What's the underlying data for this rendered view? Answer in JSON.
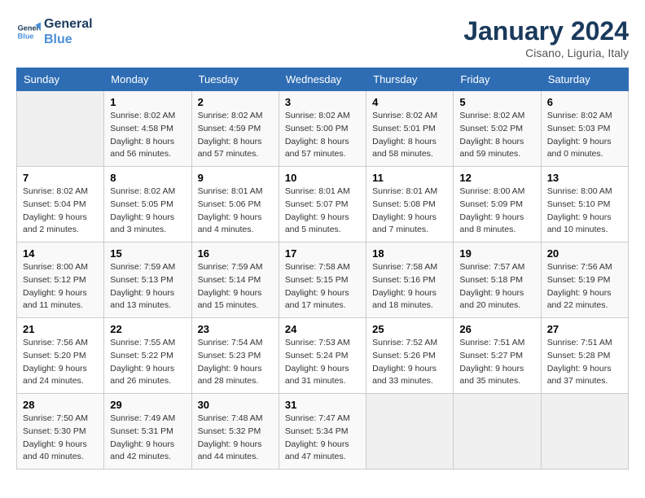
{
  "header": {
    "logo_line1": "General",
    "logo_line2": "Blue",
    "month": "January 2024",
    "location": "Cisano, Liguria, Italy"
  },
  "days_of_week": [
    "Sunday",
    "Monday",
    "Tuesday",
    "Wednesday",
    "Thursday",
    "Friday",
    "Saturday"
  ],
  "weeks": [
    [
      {
        "num": "",
        "info": ""
      },
      {
        "num": "1",
        "info": "Sunrise: 8:02 AM\nSunset: 4:58 PM\nDaylight: 8 hours\nand 56 minutes."
      },
      {
        "num": "2",
        "info": "Sunrise: 8:02 AM\nSunset: 4:59 PM\nDaylight: 8 hours\nand 57 minutes."
      },
      {
        "num": "3",
        "info": "Sunrise: 8:02 AM\nSunset: 5:00 PM\nDaylight: 8 hours\nand 57 minutes."
      },
      {
        "num": "4",
        "info": "Sunrise: 8:02 AM\nSunset: 5:01 PM\nDaylight: 8 hours\nand 58 minutes."
      },
      {
        "num": "5",
        "info": "Sunrise: 8:02 AM\nSunset: 5:02 PM\nDaylight: 8 hours\nand 59 minutes."
      },
      {
        "num": "6",
        "info": "Sunrise: 8:02 AM\nSunset: 5:03 PM\nDaylight: 9 hours\nand 0 minutes."
      }
    ],
    [
      {
        "num": "7",
        "info": "Sunrise: 8:02 AM\nSunset: 5:04 PM\nDaylight: 9 hours\nand 2 minutes."
      },
      {
        "num": "8",
        "info": "Sunrise: 8:02 AM\nSunset: 5:05 PM\nDaylight: 9 hours\nand 3 minutes."
      },
      {
        "num": "9",
        "info": "Sunrise: 8:01 AM\nSunset: 5:06 PM\nDaylight: 9 hours\nand 4 minutes."
      },
      {
        "num": "10",
        "info": "Sunrise: 8:01 AM\nSunset: 5:07 PM\nDaylight: 9 hours\nand 5 minutes."
      },
      {
        "num": "11",
        "info": "Sunrise: 8:01 AM\nSunset: 5:08 PM\nDaylight: 9 hours\nand 7 minutes."
      },
      {
        "num": "12",
        "info": "Sunrise: 8:00 AM\nSunset: 5:09 PM\nDaylight: 9 hours\nand 8 minutes."
      },
      {
        "num": "13",
        "info": "Sunrise: 8:00 AM\nSunset: 5:10 PM\nDaylight: 9 hours\nand 10 minutes."
      }
    ],
    [
      {
        "num": "14",
        "info": "Sunrise: 8:00 AM\nSunset: 5:12 PM\nDaylight: 9 hours\nand 11 minutes."
      },
      {
        "num": "15",
        "info": "Sunrise: 7:59 AM\nSunset: 5:13 PM\nDaylight: 9 hours\nand 13 minutes."
      },
      {
        "num": "16",
        "info": "Sunrise: 7:59 AM\nSunset: 5:14 PM\nDaylight: 9 hours\nand 15 minutes."
      },
      {
        "num": "17",
        "info": "Sunrise: 7:58 AM\nSunset: 5:15 PM\nDaylight: 9 hours\nand 17 minutes."
      },
      {
        "num": "18",
        "info": "Sunrise: 7:58 AM\nSunset: 5:16 PM\nDaylight: 9 hours\nand 18 minutes."
      },
      {
        "num": "19",
        "info": "Sunrise: 7:57 AM\nSunset: 5:18 PM\nDaylight: 9 hours\nand 20 minutes."
      },
      {
        "num": "20",
        "info": "Sunrise: 7:56 AM\nSunset: 5:19 PM\nDaylight: 9 hours\nand 22 minutes."
      }
    ],
    [
      {
        "num": "21",
        "info": "Sunrise: 7:56 AM\nSunset: 5:20 PM\nDaylight: 9 hours\nand 24 minutes."
      },
      {
        "num": "22",
        "info": "Sunrise: 7:55 AM\nSunset: 5:22 PM\nDaylight: 9 hours\nand 26 minutes."
      },
      {
        "num": "23",
        "info": "Sunrise: 7:54 AM\nSunset: 5:23 PM\nDaylight: 9 hours\nand 28 minutes."
      },
      {
        "num": "24",
        "info": "Sunrise: 7:53 AM\nSunset: 5:24 PM\nDaylight: 9 hours\nand 31 minutes."
      },
      {
        "num": "25",
        "info": "Sunrise: 7:52 AM\nSunset: 5:26 PM\nDaylight: 9 hours\nand 33 minutes."
      },
      {
        "num": "26",
        "info": "Sunrise: 7:51 AM\nSunset: 5:27 PM\nDaylight: 9 hours\nand 35 minutes."
      },
      {
        "num": "27",
        "info": "Sunrise: 7:51 AM\nSunset: 5:28 PM\nDaylight: 9 hours\nand 37 minutes."
      }
    ],
    [
      {
        "num": "28",
        "info": "Sunrise: 7:50 AM\nSunset: 5:30 PM\nDaylight: 9 hours\nand 40 minutes."
      },
      {
        "num": "29",
        "info": "Sunrise: 7:49 AM\nSunset: 5:31 PM\nDaylight: 9 hours\nand 42 minutes."
      },
      {
        "num": "30",
        "info": "Sunrise: 7:48 AM\nSunset: 5:32 PM\nDaylight: 9 hours\nand 44 minutes."
      },
      {
        "num": "31",
        "info": "Sunrise: 7:47 AM\nSunset: 5:34 PM\nDaylight: 9 hours\nand 47 minutes."
      },
      {
        "num": "",
        "info": ""
      },
      {
        "num": "",
        "info": ""
      },
      {
        "num": "",
        "info": ""
      }
    ]
  ]
}
